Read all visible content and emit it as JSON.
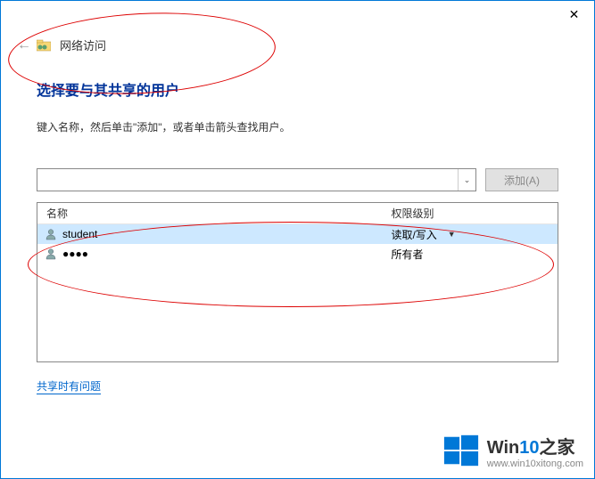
{
  "titlebar": {
    "close": "✕"
  },
  "breadcrumb": {
    "back": "←",
    "label": "网络访问"
  },
  "heading": "选择要与其共享的用户",
  "instructions": "键入名称，然后单击\"添加\"，或者单击箭头查找用户。",
  "input": {
    "value": "",
    "dropdown": "⌄"
  },
  "addButton": "添加(A)",
  "table": {
    "headers": {
      "name": "名称",
      "permission": "权限级别"
    },
    "rows": [
      {
        "user": "student",
        "permission": "读取/写入",
        "hasDropdown": true,
        "selected": true
      },
      {
        "user": "●●●●",
        "permission": "所有者",
        "hasDropdown": false,
        "selected": false
      }
    ]
  },
  "helpLink": "共享时有问题",
  "watermark": {
    "brand_pre": "Win",
    "brand_accent": "10",
    "brand_post": "之家",
    "url": "www.win10xitong.com"
  }
}
